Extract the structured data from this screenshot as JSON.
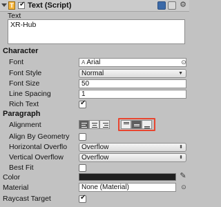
{
  "header": {
    "title": "Text (Script)",
    "icon_letter": "T",
    "enabled": true,
    "icons": [
      "book-icon",
      "preset-icon",
      "gear-icon"
    ]
  },
  "text_section": {
    "label": "Text",
    "value": "XR-Hub"
  },
  "character": {
    "heading": "Character",
    "font_label": "Font",
    "font_value": "Arial",
    "font_style_label": "Font Style",
    "font_style_value": "Normal",
    "font_size_label": "Font Size",
    "font_size_value": "50",
    "line_spacing_label": "Line Spacing",
    "line_spacing_value": "1",
    "rich_text_label": "Rich Text",
    "rich_text_checked": true
  },
  "paragraph": {
    "heading": "Paragraph",
    "alignment_label": "Alignment",
    "horizontal_buttons": [
      "align-left-icon",
      "align-center-icon",
      "align-right-icon"
    ],
    "horizontal_selected": 0,
    "vertical_buttons": [
      "align-top-icon",
      "align-middle-icon",
      "align-bottom-icon"
    ],
    "vertical_selected": 1,
    "align_by_geometry_label": "Align By Geometry",
    "align_by_geometry_checked": false,
    "horizontal_overflow_label": "Horizontal Overflo",
    "horizontal_overflow_value": "Overflow",
    "vertical_overflow_label": "Vertical Overflow",
    "vertical_overflow_value": "Overflow",
    "best_fit_label": "Best Fit",
    "best_fit_checked": false
  },
  "color": {
    "label": "Color",
    "value": "#202020"
  },
  "material": {
    "label": "Material",
    "value": "None (Material)"
  },
  "raycast": {
    "label": "Raycast Target",
    "checked": true
  },
  "colors": {
    "highlight": "#e8452f",
    "panel": "#c2c2c2",
    "selected_button": "#5e5e5e"
  }
}
